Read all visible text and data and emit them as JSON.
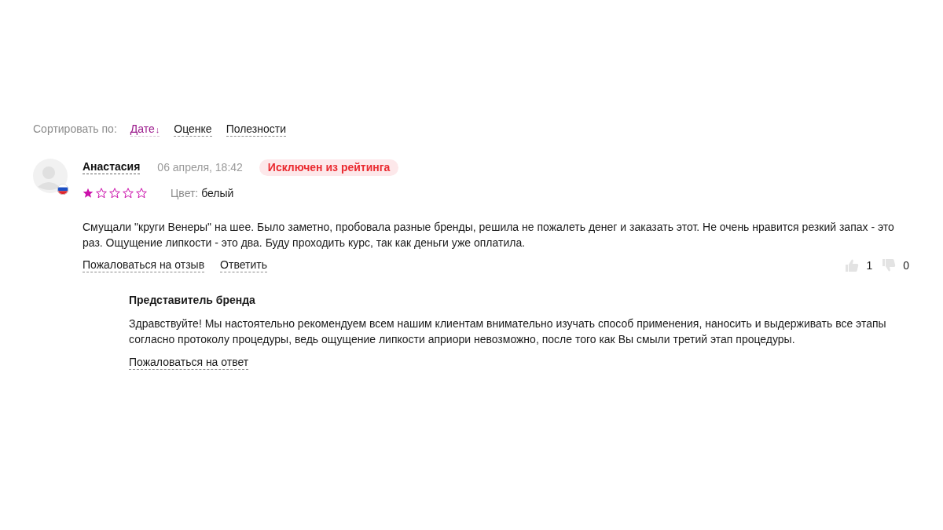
{
  "sort": {
    "label": "Сортировать по:",
    "options": [
      {
        "label": "Дате",
        "selected": true,
        "arrow": "↓"
      },
      {
        "label": "Оценке",
        "selected": false
      },
      {
        "label": "Полезности",
        "selected": false
      }
    ]
  },
  "review": {
    "author": "Анастасия",
    "date": "06 апреля, 18:42",
    "badge": "Исключен из рейтинга",
    "stars": 1,
    "color_label": "Цвет:",
    "color_value": "белый",
    "text": "Смущали \"круги Венеры\" на шее. Было заметно, пробовала разные бренды, решила не пожалеть денег и заказать этот. Не очень нравится резкий запах - это раз. Ощущение липкости - это два. Буду проходить курс, так как деньги уже оплатила.",
    "actions": [
      "Пожаловаться на отзыв",
      "Ответить"
    ],
    "likes": "1",
    "dislikes": "0",
    "reply": {
      "title": "Представитель бренда",
      "text": "Здравствуйте! Мы настоятельно рекомендуем всем нашим клиентам внимательно изучать способ применения, наносить и выдерживать все этапы согласно протоколу процедуры, ведь ощущение липкости априори невозможно, после того как Вы смыли третий этап процедуры.",
      "action": "Пожаловаться на ответ"
    }
  }
}
